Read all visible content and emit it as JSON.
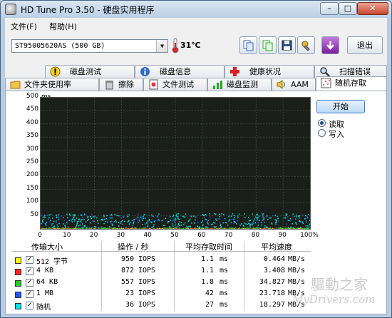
{
  "window": {
    "title": "HD Tune Pro 3.50 - 硬盘实用程序"
  },
  "caption_buttons": {
    "minimize": "–",
    "maximize": "□",
    "close": "✕"
  },
  "menu": {
    "file": "文件(F)",
    "help": "帮助(H)"
  },
  "toolbar": {
    "drive": "ST95005620AS (500 GB)",
    "temperature": "31℃",
    "exit_label": "退出"
  },
  "tabs_row1": [
    {
      "label": "磁盘测试",
      "icon": "exclamation-icon"
    },
    {
      "label": "磁盘信息",
      "icon": "info-icon"
    },
    {
      "label": "健康状况",
      "icon": "health-cross-icon"
    },
    {
      "label": "扫描错误",
      "icon": "magnifier-icon"
    }
  ],
  "tabs_row2": [
    {
      "label": "文件夹使用率",
      "icon": "folder-icon"
    },
    {
      "label": "擦除",
      "icon": "trash-icon"
    },
    {
      "label": "文件测试",
      "icon": "file-test-icon"
    },
    {
      "label": "磁盘监测",
      "icon": "monitor-icon"
    },
    {
      "label": "AAM",
      "icon": "speaker-icon"
    },
    {
      "label": "随机存取",
      "icon": "random-access-icon",
      "active": true
    }
  ],
  "controls": {
    "start_label": "开始",
    "read_label": "读取",
    "write_label": "写入",
    "selected_mode": "read"
  },
  "chart_data": {
    "type": "scatter",
    "ylabel": "ms",
    "y_ticks": [
      "500",
      "450",
      "400",
      "350",
      "300",
      "250",
      "200",
      "150",
      "100",
      "50"
    ],
    "x_ticks": [
      "0",
      "10",
      "20",
      "30",
      "40",
      "50",
      "60",
      "70",
      "80",
      "90",
      "100%"
    ],
    "ylim": [
      0,
      500
    ],
    "xlim": [
      0,
      100
    ],
    "grid": true,
    "background": "#1a1f1a",
    "series": [
      {
        "name": "512 字节",
        "color": "#ffff00",
        "y_band": [
          1,
          4
        ]
      },
      {
        "name": "4 KB",
        "color": "#ff2020",
        "y_band": [
          1,
          4
        ]
      },
      {
        "name": "64 KB",
        "color": "#22cc22",
        "y_band": [
          1,
          6
        ]
      },
      {
        "name": "1 MB",
        "color": "#2255ff",
        "y_band": [
          20,
          60
        ]
      },
      {
        "name": "随机",
        "color": "#00e5e5",
        "y_band": [
          5,
          60
        ]
      }
    ]
  },
  "table": {
    "headers": [
      "传输大小",
      "操作 / 秒",
      "平均存取时间",
      "平均速度"
    ],
    "rows": [
      {
        "label": "512 字节",
        "color": "#ffff00",
        "checked": "✓",
        "ops": "950",
        "ops_unit": "IOPS",
        "access": "1.1",
        "access_unit": "ms",
        "speed": "0.464",
        "speed_unit": "MB/s"
      },
      {
        "label": "4 KB",
        "color": "#ff2020",
        "checked": "✓",
        "ops": "872",
        "ops_unit": "IOPS",
        "access": "1.1",
        "access_unit": "ms",
        "speed": "3.408",
        "speed_unit": "MB/s"
      },
      {
        "label": "64 KB",
        "color": "#22cc22",
        "checked": "✓",
        "ops": "557",
        "ops_unit": "IOPS",
        "access": "1.8",
        "access_unit": "ms",
        "speed": "34.827",
        "speed_unit": "MB/s"
      },
      {
        "label": "1 MB",
        "color": "#2255ff",
        "checked": "✓",
        "ops": "23",
        "ops_unit": "IOPS",
        "access": "42",
        "access_unit": "ms",
        "speed": "23.718",
        "speed_unit": "MB/s"
      },
      {
        "label": "随机",
        "color": "#00e5e5",
        "checked": "✓",
        "ops": "36",
        "ops_unit": "IOPS",
        "access": "27",
        "access_unit": "ms",
        "speed": "18.297",
        "speed_unit": "MB/s"
      }
    ]
  },
  "watermark": {
    "line1": "驅動之家",
    "line2": "MyDrivers.com"
  }
}
